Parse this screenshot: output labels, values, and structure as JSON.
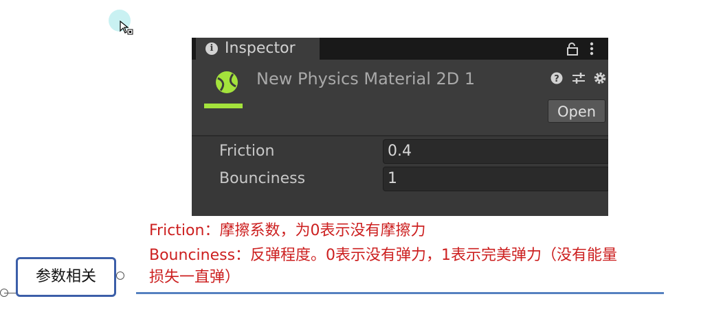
{
  "inspector": {
    "tab_label": "Inspector",
    "asset_title": "New Physics Material 2D 1",
    "open_label": "Open",
    "asset_accent": "#a4e33c",
    "properties": [
      {
        "label": "Friction",
        "value": "0.4"
      },
      {
        "label": "Bounciness",
        "value": "1"
      }
    ]
  },
  "notes": {
    "friction_line": "Friction：摩擦系数，为0表示没有摩擦力",
    "bounciness_line1": "Bounciness：反弹程度。0表示没有弹力，1表示完美弹力（没有能量",
    "bounciness_line2": "损失一直弹）",
    "color": "#cc1f1f"
  },
  "mindmap": {
    "node_label": "参数相关",
    "node_border_color": "#3b5ea8"
  }
}
